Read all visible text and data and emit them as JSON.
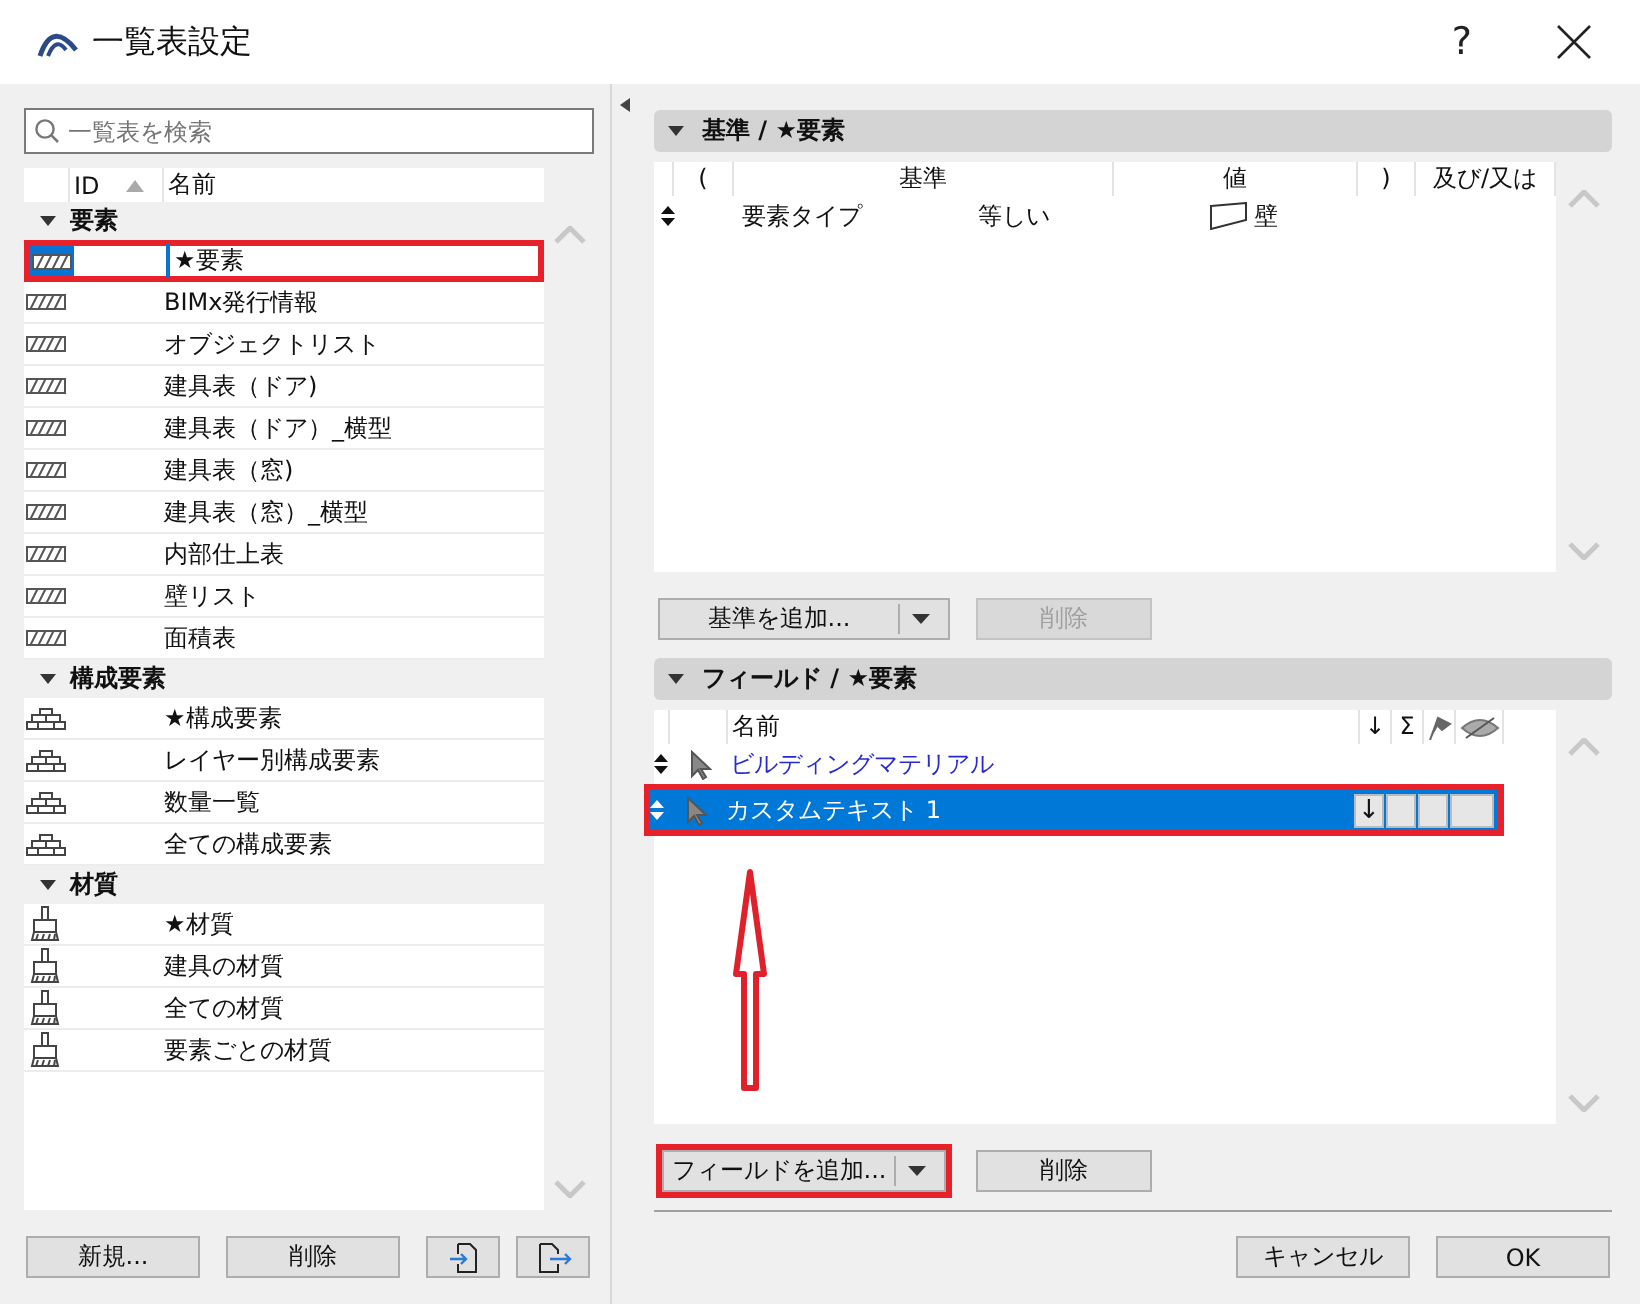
{
  "window": {
    "title": "一覧表設定",
    "help": "?"
  },
  "left": {
    "search": {
      "placeholder": "一覧表を検索"
    },
    "columns": [
      "ID",
      "名前"
    ],
    "groups": [
      {
        "label": "要素",
        "expanded": true,
        "kind": "hatch",
        "items": [
          {
            "name": "★要素",
            "selected": true,
            "callout": true
          },
          {
            "name": "BIMx発行情報",
            "selected": false,
            "callout": false
          },
          {
            "name": "オブジェクトリスト",
            "selected": false,
            "callout": false
          },
          {
            "name": "建具表（ドア)",
            "selected": false,
            "callout": false
          },
          {
            "name": "建具表（ドア）_横型",
            "selected": false,
            "callout": false
          },
          {
            "name": "建具表（窓)",
            "selected": false,
            "callout": false
          },
          {
            "name": "建具表（窓）_横型",
            "selected": false,
            "callout": false
          },
          {
            "name": "内部仕上表",
            "selected": false,
            "callout": false
          },
          {
            "name": "壁リスト",
            "selected": false,
            "callout": false
          },
          {
            "name": "面積表",
            "selected": false,
            "callout": false
          }
        ]
      },
      {
        "label": "構成要素",
        "expanded": true,
        "kind": "bricks",
        "items": [
          {
            "name": "★構成要素",
            "selected": false,
            "callout": false
          },
          {
            "name": "レイヤー別構成要素",
            "selected": false,
            "callout": false
          },
          {
            "name": "数量一覧",
            "selected": false,
            "callout": false
          },
          {
            "name": "全ての構成要素",
            "selected": false,
            "callout": false
          }
        ]
      },
      {
        "label": "材質",
        "expanded": true,
        "kind": "brush",
        "items": [
          {
            "name": "★材質",
            "selected": false,
            "callout": false
          },
          {
            "name": "建具の材質",
            "selected": false,
            "callout": false
          },
          {
            "name": "全ての材質",
            "selected": false,
            "callout": false
          },
          {
            "name": "要素ごとの材質",
            "selected": false,
            "callout": false
          }
        ]
      }
    ],
    "buttons": [
      "新規...",
      "削除"
    ]
  },
  "criteria": {
    "title": "基準 /  ★要素",
    "expanded": true,
    "columns": [
      "(",
      "基準",
      "値",
      ")",
      "及び/又は"
    ],
    "rows": [
      {
        "criterion": "要素タイプ",
        "operator": "等しい",
        "value": "壁"
      }
    ],
    "add_button": {
      "label": "基準を追加...",
      "callout": false
    },
    "delete_button": {
      "label": "削除",
      "disabled": true
    }
  },
  "fields": {
    "title": "フィールド /  ★要素",
    "expanded": true,
    "columns": [
      "名前",
      "↓",
      "Σ"
    ],
    "rows": [
      {
        "name": "ビルディングマテリアル",
        "linked": true,
        "selected": false,
        "callout": false
      },
      {
        "name": "カスタムテキスト  1",
        "linked": false,
        "selected": true,
        "callout": true,
        "sort": "↓"
      }
    ],
    "arrow_annotation": true,
    "add_button": {
      "label": "フィールドを追加...",
      "callout": true
    },
    "delete_button": {
      "label": "削除",
      "disabled": false
    }
  },
  "footer": {
    "buttons": [
      "キャンセル",
      "OK"
    ]
  }
}
